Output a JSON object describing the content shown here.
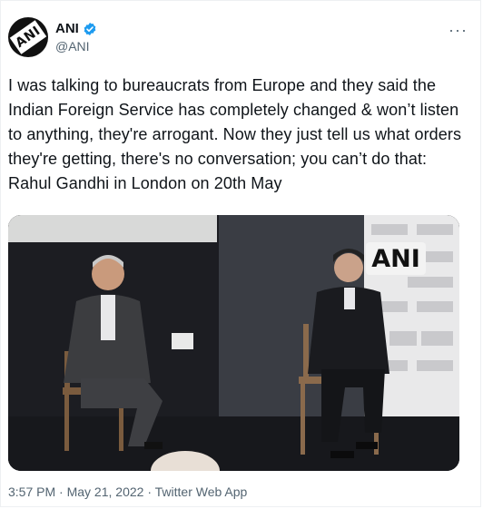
{
  "author": {
    "name": "ANI",
    "handle": "@ANI",
    "avatar_text": "ANI",
    "verified": true
  },
  "more_label": "···",
  "tweet": {
    "text": "I was talking to bureaucrats from Europe and they said the Indian Foreign Service has completely changed & won’t listen to anything, they're arrogant. Now they just tell us what orders they're getting, there's no conversation; you can’t do that: Rahul Gandhi in London on 20th May"
  },
  "media": {
    "watermark": "ANI"
  },
  "footer": {
    "time": "3:57 PM",
    "sep1": " · ",
    "date": "May 21, 2022",
    "sep2": " · ",
    "client": "Twitter Web App"
  },
  "colors": {
    "verified": "#1d9bf0",
    "secondary_text": "#536471",
    "primary_text": "#0f1419"
  }
}
